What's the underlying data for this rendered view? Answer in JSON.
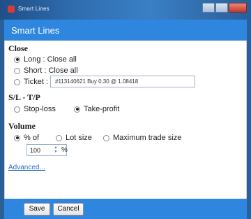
{
  "window": {
    "title": "Smart Lines"
  },
  "header": {
    "title": "Smart Lines"
  },
  "close_section": {
    "title": "Close",
    "options": [
      {
        "label": "Long : Close all",
        "checked": true
      },
      {
        "label": "Short : Close all",
        "checked": false
      },
      {
        "label": "Ticket :",
        "checked": false
      }
    ],
    "ticket_value": "#113140621 Buy 0.30 @ 1.08418"
  },
  "sltp_section": {
    "title": "S/L - T/P",
    "options": [
      {
        "label": "Stop-loss",
        "checked": false
      },
      {
        "label": "Take-profit",
        "checked": true
      }
    ]
  },
  "volume_section": {
    "title": "Volume",
    "options": [
      {
        "label": "% of",
        "checked": true
      },
      {
        "label": "Lot size",
        "checked": false
      },
      {
        "label": "Maximum trade size",
        "checked": false
      }
    ],
    "percent_value": "100",
    "percent_unit": "%"
  },
  "advanced_link": "Advanced...",
  "buttons": {
    "save": "Save",
    "cancel": "Cancel"
  }
}
